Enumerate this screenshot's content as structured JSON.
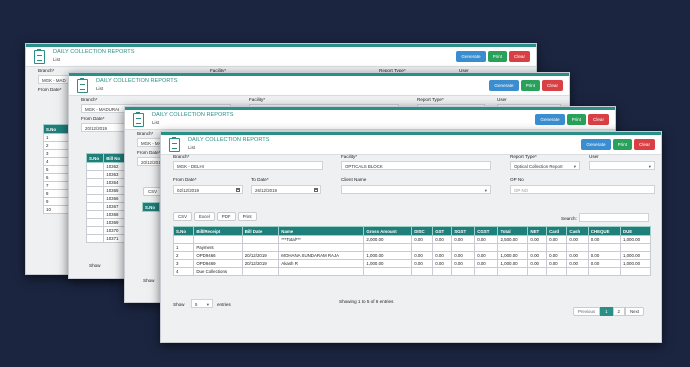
{
  "report": {
    "title": "DAILY COLLECTION REPORTS",
    "subtitle": "List",
    "buttons": {
      "generate": "Generate",
      "print": "Print",
      "clear": "Clear"
    },
    "labels": {
      "branch": "Branch*",
      "facility": "Facility*",
      "report_type": "Report Type*",
      "user": "User",
      "from_date": "From Date*",
      "to_date": "To Date*",
      "client_name": "Client Name",
      "op_no": "OP No"
    }
  },
  "windows": [
    {
      "branch": "MGK - MAD",
      "sno_values": [
        "1",
        "2",
        "3",
        "4",
        "5",
        "6",
        "7",
        "8",
        "9",
        "10"
      ]
    },
    {
      "branch": "MGK - MADURAI",
      "facility": "PHARMA BLOCK",
      "report_type": "Pharmacy Collection Repo",
      "from_date": "20/12/2019",
      "columns": [
        "S.No",
        "Bill No"
      ],
      "bill_nos": [
        "10362",
        "10363",
        "10364",
        "10365",
        "10366",
        "10367",
        "10368",
        "10369",
        "10370",
        "10371"
      ],
      "show": "Show"
    },
    {
      "branch": "MGK - MADURAI",
      "from_date": "20/12/2019",
      "csv": "CSV",
      "columns": [
        "S.No"
      ],
      "show": "Show"
    }
  ],
  "front": {
    "branch": "MGK - DELHI",
    "facility": "OPTICALS BLOCK",
    "report_type": "Optical Collection Report",
    "from_date": "02/12/2019",
    "to_date": "26/12/2019",
    "op_no_placeholder": "OP NO",
    "export_buttons": [
      "CSV",
      "Excel",
      "PDF",
      "Print"
    ],
    "search_label": "Search:",
    "columns": [
      "S.No",
      "Bill/Receipt",
      "Bill Date",
      "Name",
      "Gross Amount",
      "DISC",
      "GST",
      "SGST",
      "CGST",
      "Total",
      "NET",
      "Card",
      "Cash",
      "CHEQUE",
      "DUE"
    ],
    "rows": [
      [
        "",
        "",
        "",
        "***Total***",
        "2,000.00",
        "0.00",
        "0.00",
        "0.00",
        "0.00",
        "2,500.00",
        "0.00",
        "0.00",
        "0.00",
        "0.00",
        "1,000.00"
      ],
      [
        "1",
        "Payment",
        "",
        "",
        "",
        "",
        "",
        "",
        "",
        "",
        "",
        "",
        "",
        "",
        ""
      ],
      [
        "2",
        "OPD9466",
        "20/12/2019",
        "MOHANA SUNDARAM RAJA",
        "1,000.00",
        "0.00",
        "0.00",
        "0.00",
        "0.00",
        "1,000.00",
        "0.00",
        "0.00",
        "0.00",
        "0.00",
        "1,000.00"
      ],
      [
        "3",
        "OPD9469",
        "20/12/2019",
        "Akash R",
        "1,000.00",
        "0.00",
        "0.00",
        "0.00",
        "0.00",
        "1,000.00",
        "0.00",
        "0.00",
        "0.00",
        "0.00",
        "1,000.00"
      ],
      [
        "4",
        "Due Collections",
        "",
        "",
        "",
        "",
        "",
        "",
        "",
        "",
        "",
        "",
        "",
        "",
        ""
      ]
    ],
    "show_label": "Show",
    "entries_value": "5",
    "entries_label": "entries",
    "info": "Showing 1 to 5 of 6 entries",
    "pagination": {
      "previous": "Previous",
      "pages": [
        "1",
        "2"
      ],
      "next": "Next"
    }
  }
}
